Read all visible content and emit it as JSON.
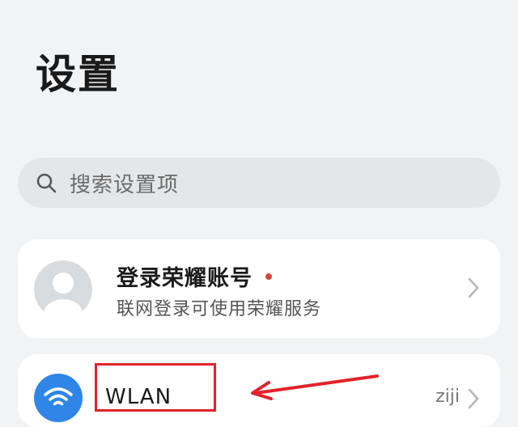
{
  "header": {
    "title": "设置"
  },
  "search": {
    "placeholder": "搜索设置项",
    "icon": "search-icon"
  },
  "account": {
    "title": "登录荣耀账号",
    "subtitle": "联网登录可使用荣耀服务",
    "avatar_icon": "avatar-icon",
    "has_notification_dot": true,
    "dot_color": "#d04a3c"
  },
  "wlan": {
    "label": "WLAN",
    "value": "ziji",
    "icon": "wifi-icon",
    "icon_color": "#2f86e6"
  },
  "annotation": {
    "highlight_color": "#e1232a"
  },
  "colors": {
    "background": "#f1f3f5",
    "card": "#ffffff",
    "search_bar": "#e4e6e8"
  }
}
